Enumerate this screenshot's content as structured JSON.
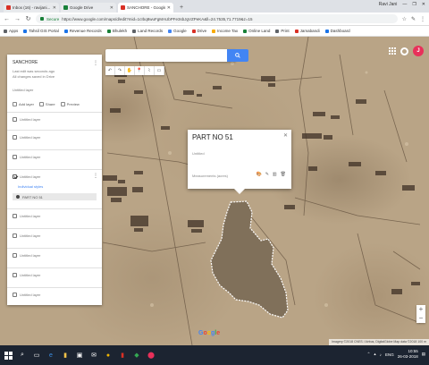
{
  "browser": {
    "tabs": [
      {
        "label": "Inbox (16) - ravijani...",
        "color": "#d93025",
        "active": false
      },
      {
        "label": "Google Drive",
        "color": "#188038",
        "active": false
      },
      {
        "label": "SANCHORE - Google M...",
        "color": "#d93025",
        "active": true
      }
    ],
    "new_tab": "+",
    "window_user": "Ravi Jani",
    "window_controls": [
      "—",
      "❐",
      "✕"
    ],
    "nav": {
      "back": "←",
      "forward": "→",
      "reload": "↻"
    },
    "secure_label": "Secure",
    "url": "https://www.google.com/maps/d/edit?mid=1cIbq8wuFgMAUbPFe3sbJgVZPeKA&ll=24.7535,71.7719&z=15",
    "bookmarks": [
      {
        "label": "Apps",
        "color": "#5f6368"
      },
      {
        "label": "Tahsil GIS Portal",
        "color": "#1a73e8"
      },
      {
        "label": "Revenue Records",
        "color": "#1a73e8"
      },
      {
        "label": "Bhulekh",
        "color": "#188038"
      },
      {
        "label": "Land Records",
        "color": "#5f6368"
      },
      {
        "label": "Google",
        "color": "#4285f4"
      },
      {
        "label": "Drive",
        "color": "#d93025"
      },
      {
        "label": "Income Tax",
        "color": "#f9ab00"
      },
      {
        "label": "Online Land",
        "color": "#188038"
      },
      {
        "label": "Print",
        "color": "#5f6368"
      },
      {
        "label": "Jamabandi",
        "color": "#d93025"
      },
      {
        "label": "Dashboard",
        "color": "#1a73e8"
      }
    ]
  },
  "map": {
    "search_placeholder": "",
    "tools": [
      "↶",
      "↷",
      "✋",
      "📍",
      "⌇",
      "▭"
    ],
    "zoom_in": "+",
    "zoom_out": "−",
    "google_logo": "Google",
    "footer_text": "Imagery ©2018 CNES / Airbus, DigitalGlobe  Map data ©2018  100 m",
    "parcel_color": "#7a6a55",
    "parcel_outline": "#ffffff"
  },
  "panel": {
    "title": "SANCHORE",
    "meta1": "Last edit was seconds ago",
    "meta2": "All changes saved in Drive",
    "description": "Untitled layer",
    "actions": [
      "Add layer",
      "Share",
      "Preview"
    ],
    "layers": [
      {
        "name": "Untitled layer",
        "checked": false
      },
      {
        "name": "Untitled layer",
        "checked": false
      },
      {
        "name": "Untitled layer",
        "checked": false
      },
      {
        "name": "Untitled layer",
        "checked": true,
        "style": "Individual styles",
        "item": "PART NO 51"
      },
      {
        "name": "Untitled layer",
        "checked": false
      },
      {
        "name": "Untitled layer",
        "checked": false
      },
      {
        "name": "Untitled layer",
        "checked": false
      },
      {
        "name": "Untitled layer",
        "checked": false
      },
      {
        "name": "Untitled layer",
        "checked": false
      }
    ],
    "base_map_label": "Base map"
  },
  "popup": {
    "title": "PART NO 51",
    "subtitle": "Untitled",
    "footer": "Measurements (acres)",
    "icons": [
      "🎨",
      "✎",
      "▥",
      "🗑"
    ],
    "close": "✕"
  },
  "taskbar": {
    "search": "⌕",
    "time": "10:55",
    "date": "26-03-2018",
    "lang": "ENG"
  }
}
